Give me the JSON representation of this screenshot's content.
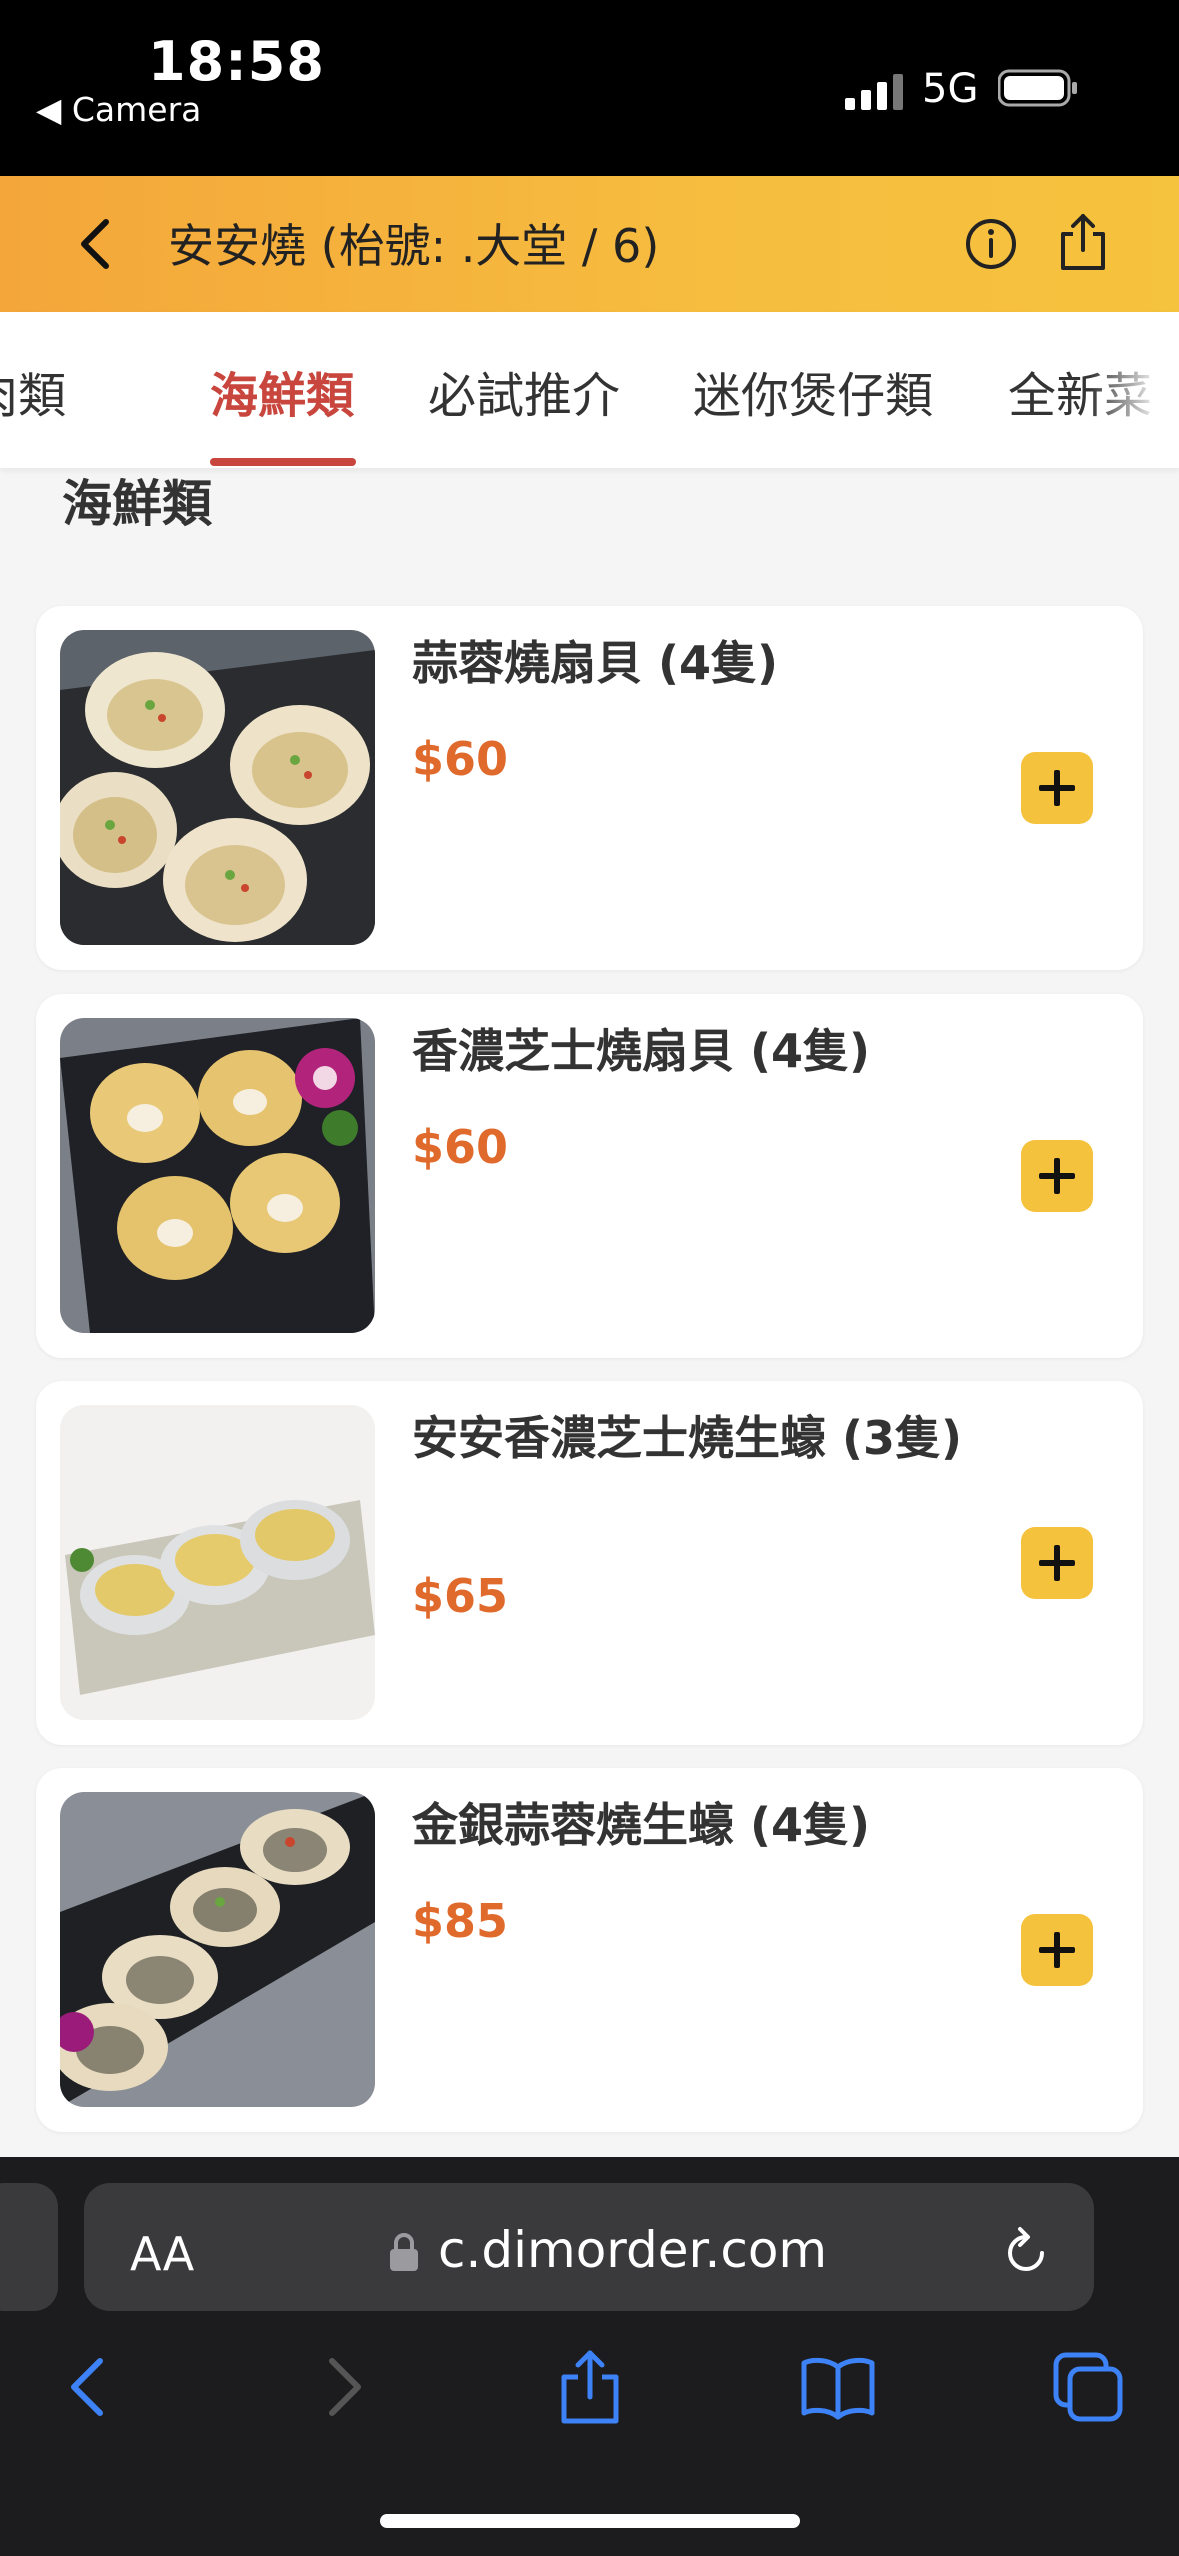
{
  "status": {
    "time": "18:58",
    "back_app": "◀ Camera",
    "network": "5G"
  },
  "header": {
    "title": "安安燒 (枱號: .大堂 / 6)"
  },
  "tabs": [
    {
      "label": "肉類"
    },
    {
      "label": "海鮮類",
      "active": true
    },
    {
      "label": "必試推介"
    },
    {
      "label": "迷你煲仔類"
    },
    {
      "label": "全新菜"
    }
  ],
  "section": {
    "title": "海鮮類"
  },
  "items": [
    {
      "name": "蒜蓉燒扇貝 (4隻)",
      "price": "$60"
    },
    {
      "name": "香濃芝士燒扇貝 (4隻)",
      "price": "$60"
    },
    {
      "name": "安安香濃芝士燒生蠔 (3隻)",
      "price": "$65"
    },
    {
      "name": "金銀蒜蓉燒生蠔 (4隻)",
      "price": "$85"
    }
  ],
  "browser": {
    "text_size": "AA",
    "url": "c.dimorder.com"
  },
  "colors": {
    "accent": "#c8463d",
    "price": "#e06a2c",
    "add_button": "#f5c23d",
    "header": "#f6bd3f"
  }
}
